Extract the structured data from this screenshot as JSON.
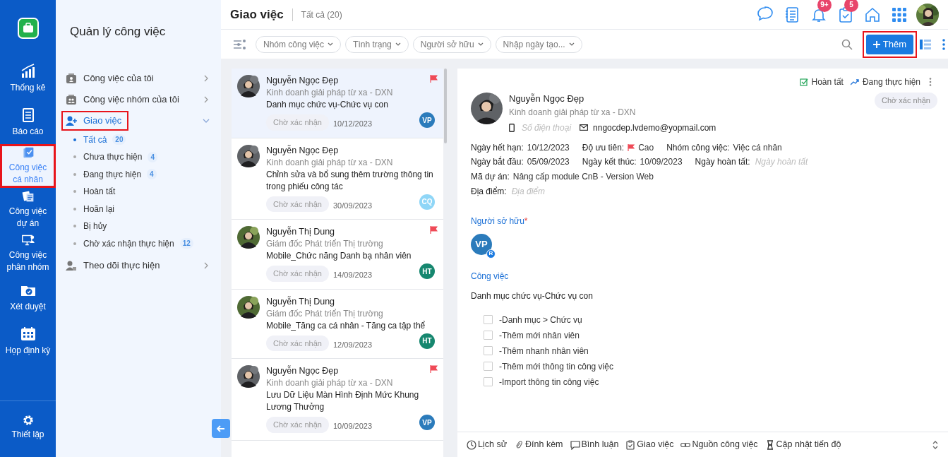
{
  "rail": {
    "items": [
      {
        "label": "Thống kê",
        "selected": false,
        "highlighted": false
      },
      {
        "label": "Báo cáo",
        "selected": false,
        "highlighted": false
      },
      {
        "label": "Công việc cá nhân",
        "selected": true,
        "highlighted": true
      },
      {
        "label": "Công việc dự án",
        "selected": false,
        "highlighted": false
      },
      {
        "label": "Công việc phân nhóm",
        "selected": false,
        "highlighted": false
      },
      {
        "label": "Xét duyệt",
        "selected": false,
        "highlighted": false
      },
      {
        "label": "Họp định kỳ",
        "selected": false,
        "highlighted": false
      }
    ],
    "footer": {
      "label": "Thiết lập"
    }
  },
  "sidebar": {
    "title": "Quản lý công việc",
    "groups": [
      {
        "label": "Công việc của tôi",
        "expanded": false,
        "highlighted": false
      },
      {
        "label": "Công việc nhóm của tôi",
        "expanded": false,
        "highlighted": false
      },
      {
        "label": "Giao việc",
        "expanded": true,
        "highlighted": true,
        "children": [
          {
            "label": "Tất cả",
            "count": "20",
            "selected": true
          },
          {
            "label": "Chưa thực hiện",
            "count": "4",
            "selected": false
          },
          {
            "label": "Đang thực hiện",
            "count": "4",
            "selected": false
          },
          {
            "label": "Hoàn tất",
            "selected": false
          },
          {
            "label": "Hoãn lại",
            "selected": false
          },
          {
            "label": "Bị hủy",
            "selected": false
          },
          {
            "label": "Chờ xác nhận thực hiện",
            "count": "12",
            "selected": false
          }
        ]
      },
      {
        "label": "Theo dõi thực hiện",
        "expanded": false,
        "highlighted": false
      }
    ]
  },
  "header": {
    "title": "Giao việc",
    "subtitle": "Tất cả (20)",
    "notification_badges": [
      "9+",
      "5"
    ]
  },
  "filters": [
    "Nhóm công việc",
    "Tình trạng",
    "Người sở hữu",
    "Nhập ngày tạo..."
  ],
  "add_button": {
    "label": "Thêm",
    "highlighted": true
  },
  "tasks": [
    {
      "name": "Nguyễn Ngọc Đẹp",
      "department": "Kinh doanh giải pháp từ xa - DXN",
      "title": "Danh mục chức vụ-Chức vụ con",
      "status": "Chờ xác nhận",
      "date": "10/12/2023",
      "assignee": "VP",
      "color": "#2b7bbb",
      "flagged": true,
      "selected": true
    },
    {
      "name": "Nguyễn Ngọc Đẹp",
      "department": "Kinh doanh giải pháp từ xa - DXN",
      "title": "Chỉnh sửa và bổ sung thêm trường thông tin trong phiếu công tác",
      "status": "Chờ xác nhận",
      "date": "30/09/2023",
      "assignee": "CQ",
      "color": "#8fd6f7",
      "flagged": false,
      "selected": false
    },
    {
      "name": "Nguyễn Thị Dung",
      "department": "Giám đốc Phát triển Thị trường",
      "title": "Mobile_Chức năng Danh bạ nhân viên",
      "status": "Chờ xác nhận",
      "date": "14/09/2023",
      "assignee": "HT",
      "color": "#16876f",
      "flagged": true,
      "selected": false
    },
    {
      "name": "Nguyễn Thị Dung",
      "department": "Giám đốc Phát triển Thị trường",
      "title": "Mobile_Tăng ca cá nhân - Tăng ca tập thể",
      "status": "Chờ xác nhận",
      "date": "12/09/2023",
      "assignee": "HT",
      "color": "#16876f",
      "flagged": false,
      "selected": false
    },
    {
      "name": "Nguyễn Ngọc Đẹp",
      "department": "Kinh doanh giải pháp từ xa - DXN",
      "title": "Lưu Dữ Liệu Màn Hình Định Mức Khung Lương Thưởng",
      "status": "Chờ xác nhận",
      "date": "10/09/2023",
      "assignee": "VP",
      "color": "#2b7bbb",
      "flagged": true,
      "selected": false
    }
  ],
  "detail": {
    "actions": [
      "Hoàn tất",
      "Đang thực hiện"
    ],
    "name": "Nguyễn Ngọc Đẹp",
    "department": "Kinh doanh giải pháp từ xa - DXN",
    "phone_placeholder": "Số điện thoại",
    "email": "nngocdep.lvdemo@yopmail.com",
    "status": "Chờ xác nhận",
    "field_rows": [
      [
        {
          "label": "Ngày hết hạn:",
          "value": "10/12/2023"
        },
        {
          "label": "Độ ưu tiên:",
          "value": "Cao",
          "flag": true
        },
        {
          "label": "Nhóm công việc:",
          "value": "Việc cá nhân"
        }
      ],
      [
        {
          "label": "Ngày bắt đầu:",
          "value": "05/09/2023"
        },
        {
          "label": "Ngày kết thúc:",
          "value": "10/09/2023"
        },
        {
          "label": "Ngày hoàn tất:",
          "placeholder": "Ngày hoàn tất"
        }
      ],
      [
        {
          "label": "Mã dự án:",
          "value": "Nâng cấp module CnB - Version Web"
        }
      ],
      [
        {
          "label": "Địa điểm:",
          "placeholder": "Địa điểm"
        }
      ]
    ],
    "owner_label": "Người sở hữu",
    "owner_required": "*",
    "owner": {
      "initials": "VP",
      "color": "#2b7bbb",
      "badge": "R"
    },
    "section_label": "Công việc",
    "task_title": "Danh mục chức vụ-Chức vụ con",
    "checklist": [
      {
        "label": "-Danh mục > Chức vụ",
        "checked": false
      },
      {
        "label": "-Thêm mới nhân viên",
        "checked": false
      },
      {
        "label": "-Thêm nhanh nhân viên",
        "checked": false
      },
      {
        "label": "-Thêm mới thông tin công việc",
        "checked": false
      },
      {
        "label": "-Import thông tin công việc",
        "checked": false
      }
    ],
    "tabs": [
      "Lịch sử",
      "Đính kèm",
      "Bình luận",
      "Giao việc",
      "Nguồn công việc",
      "Cập nhật tiến độ"
    ]
  }
}
